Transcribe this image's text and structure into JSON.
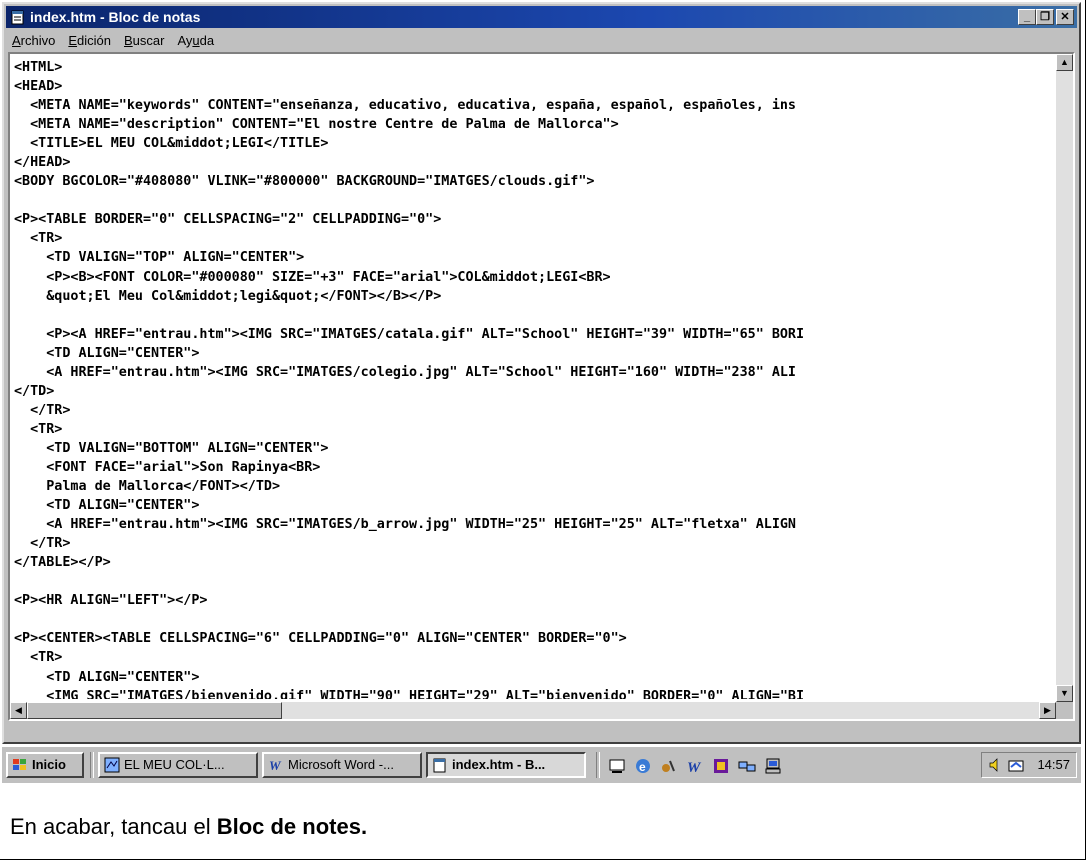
{
  "window": {
    "title": "index.htm - Bloc de notas"
  },
  "menu": [
    {
      "pre": "",
      "u": "A",
      "post": "rchivo"
    },
    {
      "pre": "",
      "u": "E",
      "post": "dición"
    },
    {
      "pre": "",
      "u": "B",
      "post": "uscar"
    },
    {
      "pre": "Ay",
      "u": "u",
      "post": "da"
    }
  ],
  "editor": {
    "lines": [
      "<HTML>",
      "<HEAD>",
      "  <META NAME=\"keywords\" CONTENT=\"enseñanza, educativo, educativa, españa, español, españoles, ins",
      "  <META NAME=\"description\" CONTENT=\"El nostre Centre de Palma de Mallorca\">",
      "  <TITLE>EL MEU COL&middot;LEGI</TITLE>",
      "</HEAD>",
      "<BODY BGCOLOR=\"#408080\" VLINK=\"#800000\" BACKGROUND=\"IMATGES/clouds.gif\">",
      "",
      "<P><TABLE BORDER=\"0\" CELLSPACING=\"2\" CELLPADDING=\"0\">",
      "  <TR>",
      "    <TD VALIGN=\"TOP\" ALIGN=\"CENTER\">",
      "    <P><B><FONT COLOR=\"#000080\" SIZE=\"+3\" FACE=\"arial\">COL&middot;LEGI<BR>",
      "    &quot;El Meu Col&middot;legi&quot;</FONT></B></P>",
      "",
      "    <P><A HREF=\"entrau.htm\"><IMG SRC=\"IMATGES/catala.gif\" ALT=\"School\" HEIGHT=\"39\" WIDTH=\"65\" BORI",
      "    <TD ALIGN=\"CENTER\">",
      "    <A HREF=\"entrau.htm\"><IMG SRC=\"IMATGES/colegio.jpg\" ALT=\"School\" HEIGHT=\"160\" WIDTH=\"238\" ALI",
      "</TD>",
      "  </TR>",
      "  <TR>",
      "    <TD VALIGN=\"BOTTOM\" ALIGN=\"CENTER\">",
      "    <FONT FACE=\"arial\">Son Rapinya<BR>",
      "    Palma de Mallorca</FONT></TD>",
      "    <TD ALIGN=\"CENTER\">",
      "    <A HREF=\"entrau.htm\"><IMG SRC=\"IMATGES/b_arrow.jpg\" WIDTH=\"25\" HEIGHT=\"25\" ALT=\"fletxa\" ALIGN",
      "  </TR>",
      "</TABLE></P>",
      "",
      "<P><HR ALIGN=\"LEFT\"></P>",
      "",
      "<P><CENTER><TABLE CELLSPACING=\"6\" CELLPADDING=\"0\" ALIGN=\"CENTER\" BORDER=\"0\">",
      "  <TR>",
      "    <TD ALIGN=\"CENTER\">",
      "    <IMG SRC=\"IMATGES/bienvenido.gif\" WIDTH=\"90\" HEIGHT=\"29\" ALT=\"bienvenido\" BORDER=\"0\" ALIGN=\"BI"
    ]
  },
  "taskbar": {
    "start": "Inicio",
    "tasks": [
      "EL MEU COL·L...",
      "Microsoft Word -...",
      "index.htm - B..."
    ],
    "clock": "14:57"
  },
  "caption": {
    "text": "En acabar, tancau el ",
    "bold": "Bloc de notes."
  }
}
